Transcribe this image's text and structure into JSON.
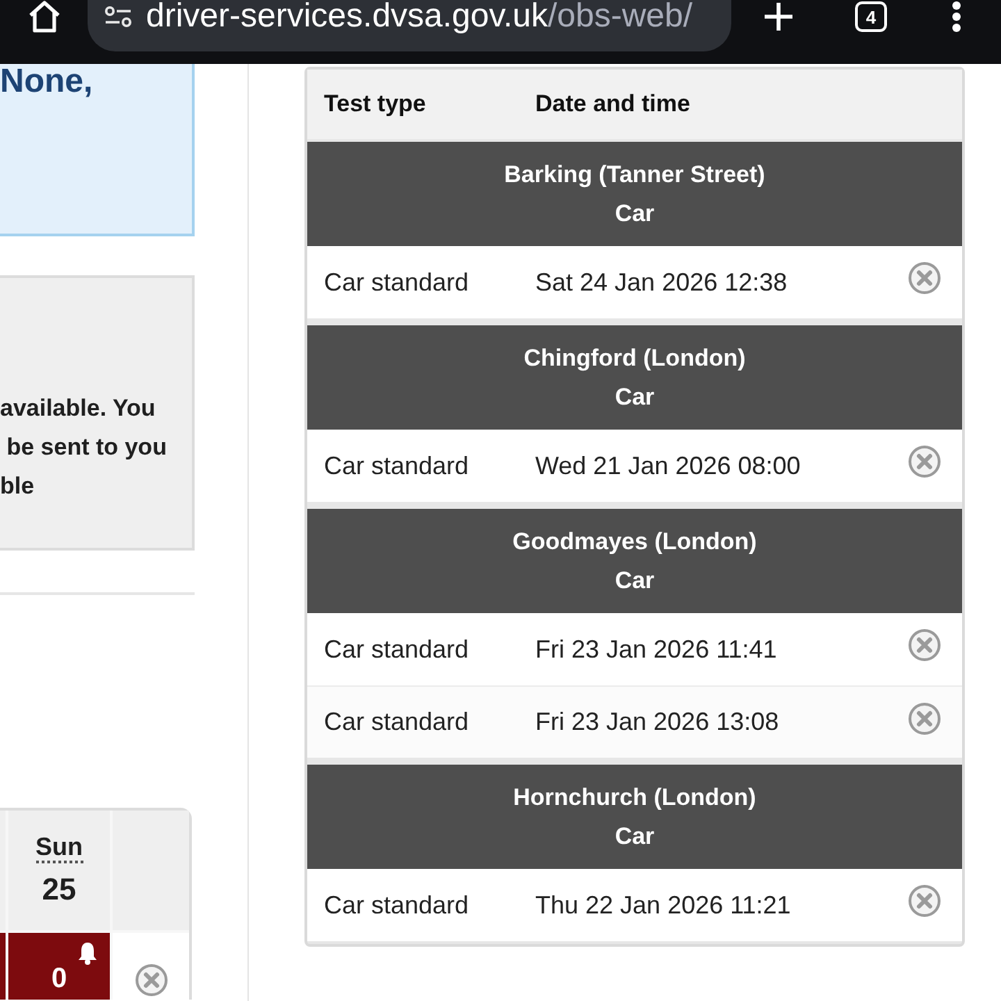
{
  "browser_bar": {
    "url_host": "driver-services.dvsa.gov.uk",
    "url_path": "/obs-web/",
    "tab_count": "4"
  },
  "left_panel": {
    "notice_heading": "None,",
    "info_message": "available. You\n be sent to you\nble",
    "calendar": {
      "day": "Sun",
      "date": "25",
      "slot_count": "0"
    }
  },
  "bookings_table": {
    "columns": [
      "Test type",
      "Date and time"
    ],
    "groups": [
      {
        "centre": "Barking (Tanner Street)",
        "vehicle": "Car",
        "rows": [
          {
            "test_type": "Car standard",
            "date_time": "Sat 24 Jan 2026 12:38"
          }
        ]
      },
      {
        "centre": "Chingford (London)",
        "vehicle": "Car",
        "rows": [
          {
            "test_type": "Car standard",
            "date_time": "Wed 21 Jan 2026 08:00"
          }
        ]
      },
      {
        "centre": "Goodmayes (London)",
        "vehicle": "Car",
        "rows": [
          {
            "test_type": "Car standard",
            "date_time": "Fri 23 Jan 2026 11:41"
          },
          {
            "test_type": "Car standard",
            "date_time": "Fri 23 Jan 2026 13:08"
          }
        ]
      },
      {
        "centre": "Hornchurch (London)",
        "vehicle": "Car",
        "rows": [
          {
            "test_type": "Car standard",
            "date_time": "Thu 22 Jan 2026 11:21"
          }
        ]
      }
    ]
  }
}
